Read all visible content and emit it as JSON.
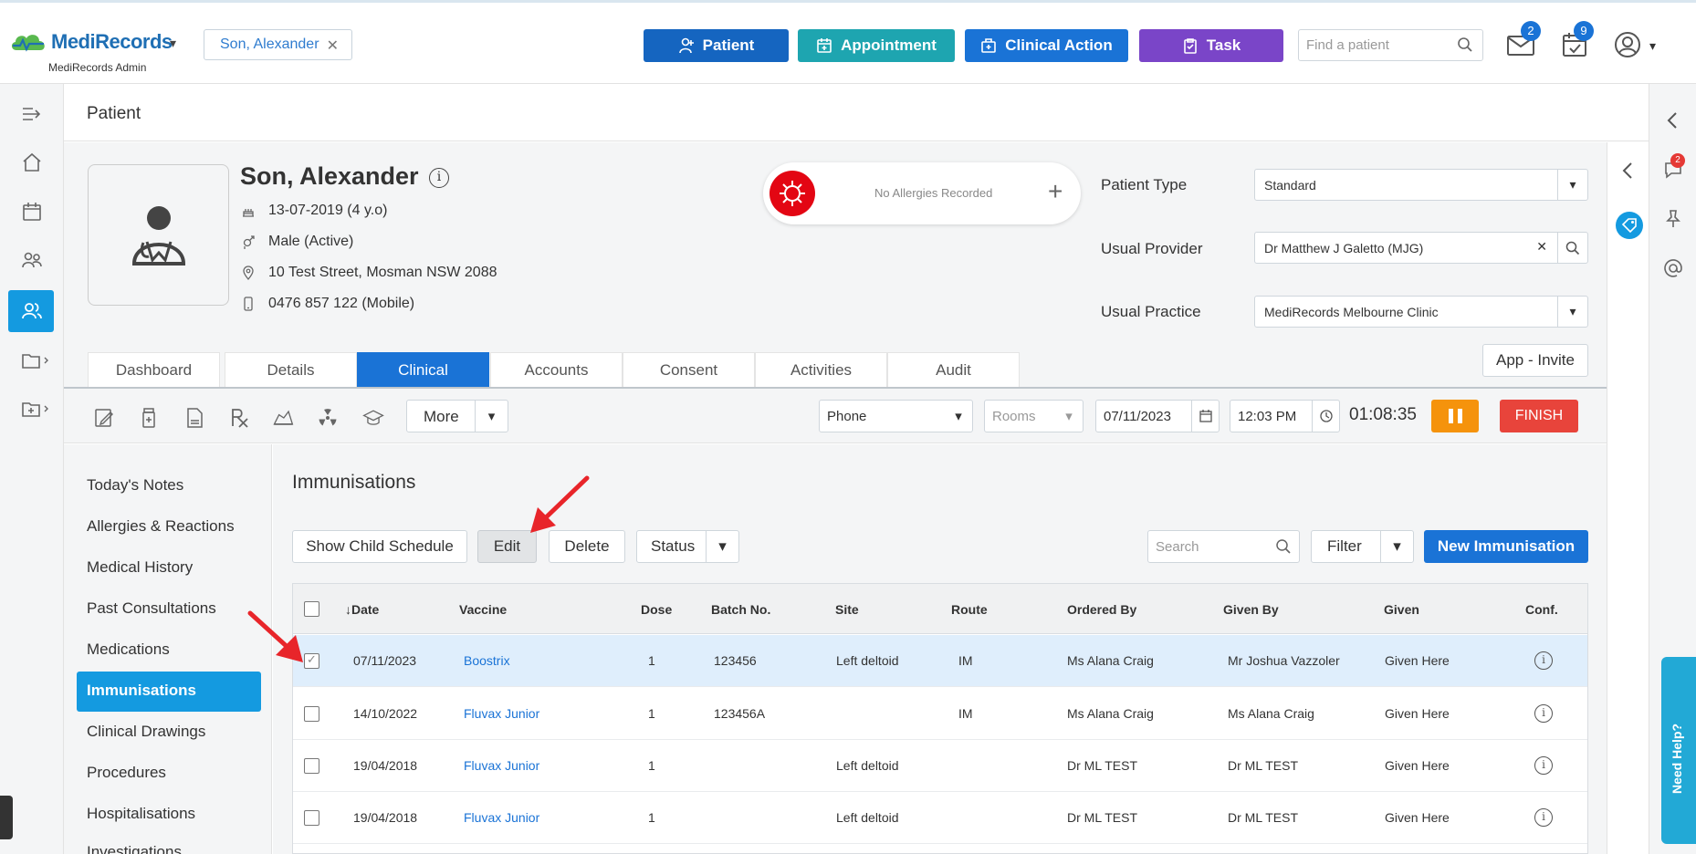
{
  "app": {
    "logo_name": "MediRecords",
    "logo_sub": "MediRecords Admin",
    "patient_tab": "Son, Alexander",
    "buttons": {
      "patient": "Patient",
      "appointment": "Appointment",
      "clinical_action": "Clinical Action",
      "task": "Task"
    },
    "find_placeholder": "Find a patient",
    "mail_count": "2",
    "calendar_count": "9",
    "chat_count": "2",
    "need_help": "Need Help?"
  },
  "page": {
    "title": "Patient"
  },
  "patient": {
    "name": "Son, Alexander",
    "dob": "13-07-2019 (4 y.o)",
    "gender": "Male (Active)",
    "address": "10 Test Street, Mosman NSW 2088",
    "phone": "0476 857 122 (Mobile)",
    "allergy_text": "No Allergies Recorded",
    "fields": {
      "patient_type_label": "Patient Type",
      "patient_type_value": "Standard",
      "provider_label": "Usual Provider",
      "provider_value": "Dr Matthew J Galetto (MJG)",
      "practice_label": "Usual Practice",
      "practice_value": "MediRecords Melbourne Clinic"
    },
    "app_invite": "App - Invite"
  },
  "tabs": [
    "Dashboard",
    "Details",
    "Clinical",
    "Accounts",
    "Consent",
    "Activities",
    "Audit"
  ],
  "toolbar": {
    "more": "More",
    "mode": "Phone",
    "rooms_placeholder": "Rooms",
    "date": "07/11/2023",
    "time": "12:03 PM",
    "timer": "01:08:35",
    "finish": "FINISH"
  },
  "clinical_menu": [
    "Today's Notes",
    "Allergies & Reactions",
    "Medical History",
    "Past Consultations",
    "Medications",
    "Immunisations",
    "Clinical Drawings",
    "Procedures",
    "Hospitalisations",
    "Investigations"
  ],
  "immunisations": {
    "title": "Immunisations",
    "show_child_schedule": "Show Child Schedule",
    "edit": "Edit",
    "delete": "Delete",
    "status": "Status",
    "search_placeholder": "Search",
    "filter": "Filter",
    "new_immunisation": "New Immunisation",
    "columns": [
      "↓Date",
      "Vaccine",
      "Dose",
      "Batch No.",
      "Site",
      "Route",
      "Ordered By",
      "Given By",
      "Given",
      "Conf."
    ],
    "rows": [
      {
        "date": "07/11/2023",
        "vaccine": "Boostrix",
        "dose": "1",
        "batch": "123456",
        "site": "Left deltoid",
        "route": "IM",
        "ordered_by": "Ms Alana Craig",
        "given_by": "Mr Joshua Vazzoler",
        "given": "Given Here"
      },
      {
        "date": "14/10/2022",
        "vaccine": "Fluvax Junior",
        "dose": "1",
        "batch": "123456A",
        "site": "",
        "route": "IM",
        "ordered_by": "Ms Alana Craig",
        "given_by": "Ms Alana Craig",
        "given": "Given Here"
      },
      {
        "date": "19/04/2018",
        "vaccine": "Fluvax Junior",
        "dose": "1",
        "batch": "",
        "site": "Left deltoid",
        "route": "",
        "ordered_by": "Dr ML TEST",
        "given_by": "Dr ML TEST",
        "given": "Given Here"
      },
      {
        "date": "19/04/2018",
        "vaccine": "Fluvax Junior",
        "dose": "1",
        "batch": "",
        "site": "Left deltoid",
        "route": "",
        "ordered_by": "Dr ML TEST",
        "given_by": "Dr ML TEST",
        "given": "Given Here"
      }
    ]
  },
  "colors": {
    "primary": "#1a73d6",
    "appointment": "#1ea5b0",
    "task": "#7a45c8",
    "active_nav": "#149ae0",
    "pause": "#f5930c",
    "finish": "#e8443b",
    "allergy": "#e30613",
    "annotation_arrow": "#e8252a"
  }
}
